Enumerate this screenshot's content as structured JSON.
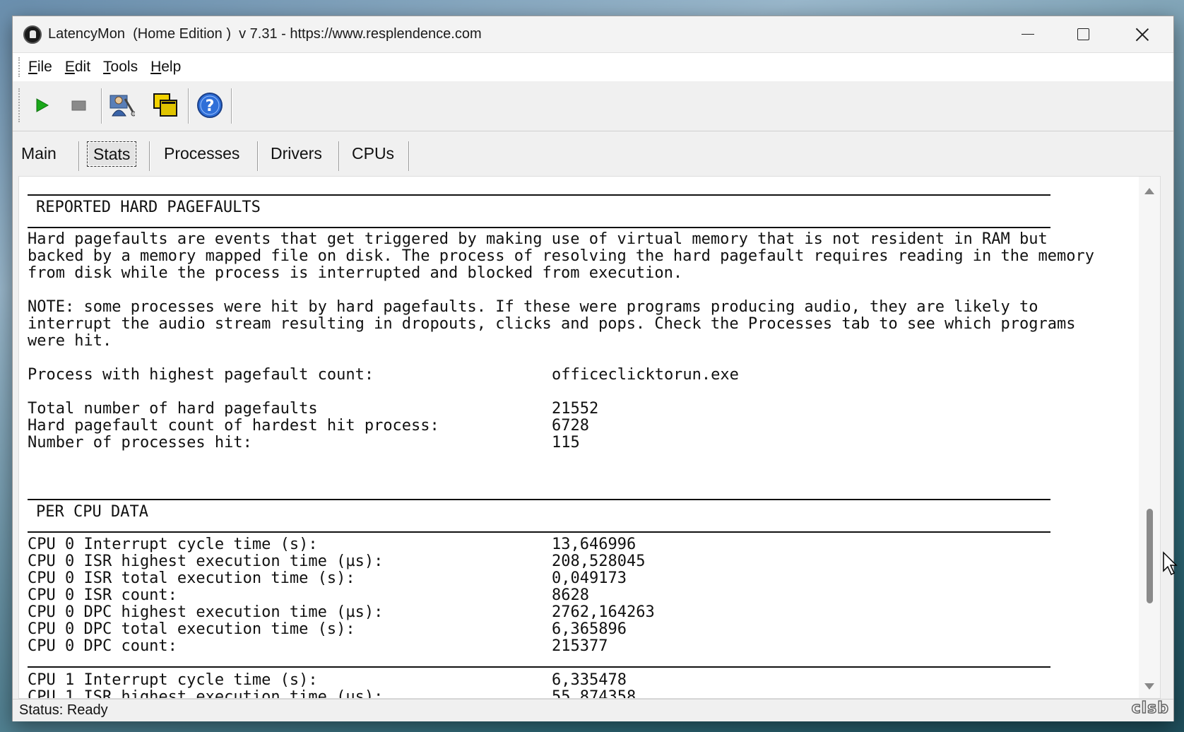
{
  "window": {
    "title": "LatencyMon  (Home Edition )  v 7.31 - https://www.resplendence.com"
  },
  "menu": [
    {
      "pre": "",
      "ul": "F",
      "post": "ile"
    },
    {
      "pre": "",
      "ul": "E",
      "post": "dit"
    },
    {
      "pre": "",
      "ul": "T",
      "post": "ools"
    },
    {
      "pre": "",
      "ul": "H",
      "post": "elp"
    }
  ],
  "toolbar": {
    "icons": [
      "play-icon",
      "stop-icon",
      "user-settings-icon",
      "copy-windows-icon",
      "help-icon"
    ],
    "colors": {
      "play": "#1aa81a",
      "stop": "#8a8a8a",
      "help": "#2f6fd8"
    }
  },
  "tabs": [
    {
      "label": "Main",
      "active": false
    },
    {
      "label": "Stats",
      "active": true
    },
    {
      "label": "Processes",
      "active": false
    },
    {
      "label": "Drivers",
      "active": false
    },
    {
      "label": "CPUs",
      "active": false
    }
  ],
  "report": {
    "pagefaults_heading": "REPORTED HARD PAGEFAULTS",
    "pagefaults_desc": [
      "Hard pagefaults are events that get triggered by making use of virtual memory that is not resident in RAM but",
      "backed by a memory mapped file on disk. The process of resolving the hard pagefault requires reading in the memory",
      "from disk while the process is interrupted and blocked from execution."
    ],
    "note": [
      "NOTE: some processes were hit by hard pagefaults. If these were programs producing audio, they are likely to",
      "interrupt the audio stream resulting in dropouts, clicks and pops. Check the Processes tab to see which programs",
      "were hit."
    ],
    "highest_process": {
      "label": "Process with highest pagefault count:",
      "value": "officeclicktorun.exe"
    },
    "pagefault_stats": [
      {
        "label": "Total number of hard pagefaults",
        "value": "21552"
      },
      {
        "label": "Hard pagefault count of hardest hit process:",
        "value": "6728"
      },
      {
        "label": "Number of processes hit:",
        "value": "115"
      }
    ],
    "per_cpu_heading": "PER CPU DATA",
    "cpu0": [
      {
        "label": "CPU 0 Interrupt cycle time (s):",
        "value": "13,646996"
      },
      {
        "label": "CPU 0 ISR highest execution time (µs):",
        "value": "208,528045"
      },
      {
        "label": "CPU 0 ISR total execution time (s):",
        "value": "0,049173"
      },
      {
        "label": "CPU 0 ISR count:",
        "value": "8628"
      },
      {
        "label": "CPU 0 DPC highest execution time (µs):",
        "value": "2762,164263"
      },
      {
        "label": "CPU 0 DPC total execution time (s):",
        "value": "6,365896"
      },
      {
        "label": "CPU 0 DPC count:",
        "value": "215377"
      }
    ],
    "cpu1": [
      {
        "label": "CPU 1 Interrupt cycle time (s):",
        "value": "6,335478"
      },
      {
        "label": "CPU 1 ISR highest execution time (µs):",
        "value": "55,874358"
      }
    ]
  },
  "status": {
    "text": "Status: Ready"
  },
  "logo": {
    "text": "clsb"
  }
}
